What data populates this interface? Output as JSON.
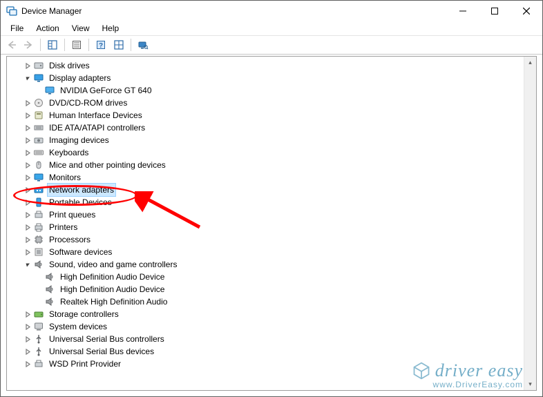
{
  "title": "Device Manager",
  "menus": {
    "file": "File",
    "action": "Action",
    "view": "View",
    "help": "Help"
  },
  "tree": {
    "disk_drives": "Disk drives",
    "display_adapters": "Display adapters",
    "display_child_1": "NVIDIA GeForce GT 640",
    "dvd": "DVD/CD-ROM drives",
    "hid": "Human Interface Devices",
    "ide": "IDE ATA/ATAPI controllers",
    "imaging": "Imaging devices",
    "keyboards": "Keyboards",
    "mice": "Mice and other pointing devices",
    "monitors": "Monitors",
    "network": "Network adapters",
    "portable": "Portable Devices",
    "print_queues": "Print queues",
    "printers": "Printers",
    "processors": "Processors",
    "software": "Software devices",
    "sound": "Sound, video and game controllers",
    "sound_child_1": "High Definition Audio Device",
    "sound_child_2": "High Definition Audio Device",
    "sound_child_3": "Realtek High Definition Audio",
    "storage": "Storage controllers",
    "system": "System devices",
    "usb_ctrl": "Universal Serial Bus controllers",
    "usb_dev": "Universal Serial Bus devices",
    "wsd": "WSD Print Provider"
  },
  "selected_node": "network",
  "watermark": {
    "brand": "driver easy",
    "url": "www.DriverEasy.com"
  }
}
